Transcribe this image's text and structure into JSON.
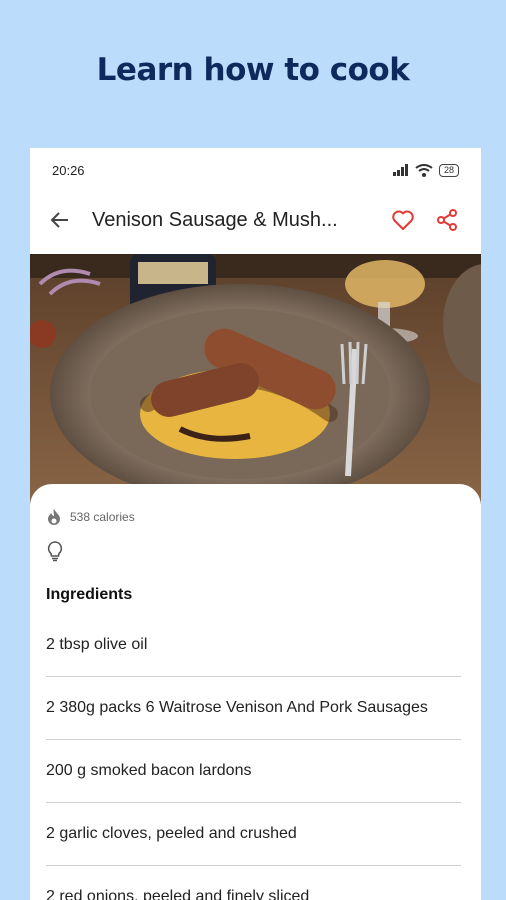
{
  "headline": "Learn how to cook",
  "status": {
    "time": "20:26",
    "battery": "28"
  },
  "appbar": {
    "title": "Venison Sausage & Mush..."
  },
  "recipe": {
    "calories": "538 calories",
    "ingredients_heading": "Ingredients",
    "ingredients": [
      "2 tbsp olive oil",
      "2 380g packs 6 Waitrose Venison And Pork Sausages",
      "200 g smoked bacon lardons",
      "2 garlic cloves, peeled and crushed",
      "2 red onions, peeled and finely sliced"
    ]
  },
  "colors": {
    "accent": "#e53935",
    "background": "#bcdcfb",
    "headline": "#0e2a5c"
  },
  "icons": [
    "back-arrow-icon",
    "heart-icon",
    "share-icon",
    "flame-icon",
    "lightbulb-icon",
    "signal-icon",
    "wifi-icon",
    "battery-icon"
  ]
}
